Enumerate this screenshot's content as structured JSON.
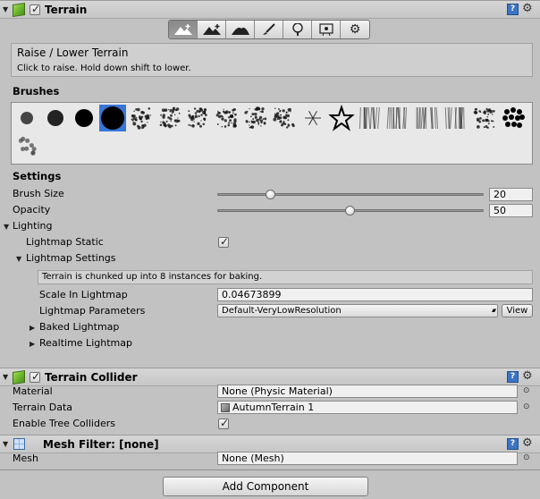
{
  "terrain": {
    "title": "Terrain",
    "enabled": true,
    "tools": [
      {
        "name": "raise-lower",
        "icon": "mountain-raise-icon",
        "active": true
      },
      {
        "name": "paint-height",
        "icon": "mountain-height-icon",
        "active": false
      },
      {
        "name": "smooth-height",
        "icon": "mountain-smooth-icon",
        "active": false
      },
      {
        "name": "paint-texture",
        "icon": "paintbrush-icon",
        "active": false
      },
      {
        "name": "place-trees",
        "icon": "tree-icon",
        "active": false
      },
      {
        "name": "paint-details",
        "icon": "flower-icon",
        "active": false
      },
      {
        "name": "settings",
        "icon": "gear-icon",
        "active": false
      }
    ],
    "tool_title": "Raise / Lower Terrain",
    "tool_hint": "Click to raise. Hold down shift to lower.",
    "brushes_label": "Brushes",
    "brush_count": 19,
    "selected_brush": 3,
    "settings_label": "Settings",
    "brush_size": {
      "label": "Brush Size",
      "value": "20",
      "fraction": 0.2
    },
    "opacity": {
      "label": "Opacity",
      "value": "50",
      "fraction": 0.5
    },
    "lighting": {
      "label": "Lighting",
      "lightmap_static_label": "Lightmap Static",
      "lightmap_static": true,
      "lightmap_settings_label": "Lightmap Settings",
      "notice": "Terrain is chunked up into 8 instances for baking.",
      "scale_label": "Scale In Lightmap",
      "scale_value": "0.04673899",
      "params_label": "Lightmap Parameters",
      "params_value": "Default-VeryLowResolution",
      "view_label": "View",
      "baked_label": "Baked Lightmap",
      "realtime_label": "Realtime Lightmap"
    }
  },
  "collider": {
    "title": "Terrain Collider",
    "enabled": true,
    "material_label": "Material",
    "material_value": "None (Physic Material)",
    "terrain_data_label": "Terrain Data",
    "terrain_data_value": "AutumnTerrain 1",
    "tree_colliders_label": "Enable Tree Colliders",
    "tree_colliders": true
  },
  "mesh_filter": {
    "title": "Mesh Filter: [none]",
    "mesh_label": "Mesh",
    "mesh_value": "None (Mesh)"
  },
  "add_component_label": "Add Component",
  "glyphs": {
    "help": "?",
    "gear": "⚙",
    "check": "✓",
    "picker": "⊙",
    "fold_open": "▼",
    "fold_closed": "▶",
    "dropdown": "▴▾"
  }
}
